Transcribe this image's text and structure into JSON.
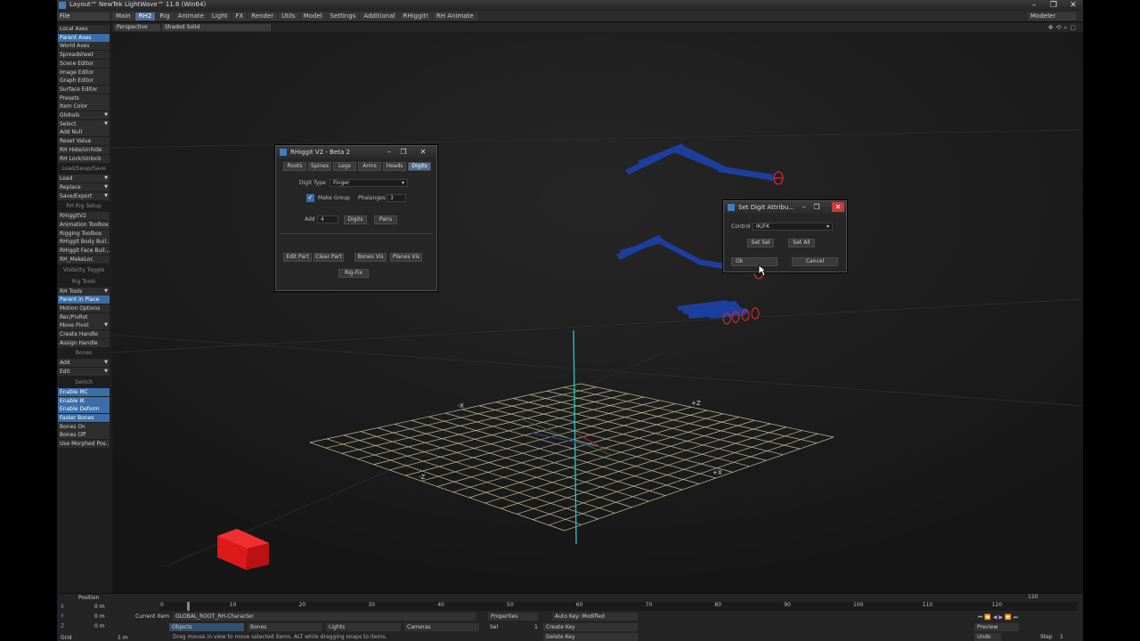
{
  "window": {
    "title": "Layout™ NewTek LightWave™ 11.6 (Win64)",
    "minimize": "–",
    "maximize": "❐",
    "close": "✕"
  },
  "menubar": {
    "file": "File",
    "tabs": [
      "Main",
      "RH2",
      "Rig",
      "Animate",
      "Light",
      "FX",
      "Render",
      "Utils",
      "Model",
      "Settings",
      "Additional",
      "RHiggit!",
      "RH Animate"
    ],
    "active_tab": "RH2",
    "modeler": "Modeler"
  },
  "viewport_bar": {
    "view": "Perspective",
    "shading": "Shaded Solid"
  },
  "toolbar": {
    "items": [
      {
        "label": "Local Axes",
        "style": "btn"
      },
      {
        "label": "Parent Axes",
        "style": "hl"
      },
      {
        "label": "World Axes",
        "style": "btn"
      },
      {
        "label": "Spreadsheet",
        "style": "btn"
      },
      {
        "label": "Scene Editor",
        "style": "btn"
      },
      {
        "label": "Image Editor",
        "style": "btn"
      },
      {
        "label": "Graph Editor",
        "style": "btn"
      },
      {
        "label": "Surface Editor",
        "style": "btn"
      },
      {
        "label": "Presets",
        "style": "btn"
      },
      {
        "label": "Item Color",
        "style": "btn"
      },
      {
        "label": "Globals",
        "style": "btn",
        "arrow": true
      },
      {
        "label": "Select",
        "style": "btn",
        "arrow": true
      },
      {
        "label": "Add Null",
        "style": "btn"
      },
      {
        "label": "Reset Value",
        "style": "btn"
      },
      {
        "label": "RH Hide/Unhide",
        "style": "btn"
      },
      {
        "label": "RH Lock/Unlock",
        "style": "btn"
      },
      {
        "label": "Load/Swap/Save",
        "style": "hdr"
      },
      {
        "label": "Load",
        "style": "btn",
        "arrow": true
      },
      {
        "label": "Replace",
        "style": "btn",
        "arrow": true
      },
      {
        "label": "Save/Export",
        "style": "btn",
        "arrow": true
      },
      {
        "label": "RH Rig Setup",
        "style": "hdr"
      },
      {
        "label": "RHiggitV2",
        "style": "btn"
      },
      {
        "label": "Animation Toolbox",
        "style": "btn"
      },
      {
        "label": "Rigging Toolbox",
        "style": "btn"
      },
      {
        "label": "RHiggit Body Buil...",
        "style": "btn"
      },
      {
        "label": "RHiggit Face Buil...",
        "style": "btn"
      },
      {
        "label": "RH_MakeLoc",
        "style": "btn"
      },
      {
        "label": "Visibility Toggle",
        "style": "hdr"
      },
      {
        "label": "Rig Tools",
        "style": "hdr"
      },
      {
        "label": "RH Tools",
        "style": "btn",
        "arrow": true
      },
      {
        "label": "Parent in Place",
        "style": "hl"
      },
      {
        "label": "Motion Options",
        "style": "btn"
      },
      {
        "label": "Rec/PivRot",
        "style": "btn"
      },
      {
        "label": "Move Pivot",
        "style": "btn",
        "arrow": true
      },
      {
        "label": "Create Handle",
        "style": "btn"
      },
      {
        "label": "Assign Handle",
        "style": "btn"
      },
      {
        "label": "Bones",
        "style": "hdr"
      },
      {
        "label": "Add",
        "style": "btn",
        "arrow": true
      },
      {
        "label": "Edit",
        "style": "btn",
        "arrow": true
      },
      {
        "label": "Switch",
        "style": "hdr"
      },
      {
        "label": "Enable MC",
        "style": "hl"
      },
      {
        "label": "Enable IK",
        "style": "hl"
      },
      {
        "label": "Enable Deform",
        "style": "hl"
      },
      {
        "label": "Faster Bones",
        "style": "hl"
      },
      {
        "label": "Bones On",
        "style": "btn"
      },
      {
        "label": "Bones Off",
        "style": "btn"
      },
      {
        "label": "Use Morphed Pos...",
        "style": "btn"
      }
    ]
  },
  "viewport": {
    "axis_labels": [
      "-X",
      "+Z",
      "-Z",
      "+X"
    ],
    "controller_color": "#1c3f9e",
    "target_color": "#e03030",
    "cube_color": "#dd1a1a",
    "grid_color": "#c8c8a0",
    "y_axis_color": "#28c0c0"
  },
  "rhiggit_dialog": {
    "title": "RHiggit V2 - Beta 2",
    "tabs": [
      "Roots",
      "Spines",
      "Legs",
      "Arms",
      "Heads",
      "Digits"
    ],
    "active_tab": "Digits",
    "digit_type_label": "Digit Type",
    "digit_type_value": "Finger",
    "make_group_label": "Make Group",
    "phalanges_label": "Phalanges",
    "phalanges_value": "3",
    "add_label": "Add",
    "add_value": "4",
    "digits_button": "Digits",
    "pairs_button": "Pairs",
    "edit_part": "Edit Part",
    "clear_part": "Clear Part",
    "bones_vis": "Bones Vis",
    "planes_vis": "Planes Vis",
    "rig_fix": "Rig-Fix"
  },
  "set_digit_dialog": {
    "title": "Set Digit Attribu...",
    "control_label": "Control",
    "control_value": "IK/FK",
    "set_sel": "Set Sel",
    "set_all": "Set All",
    "ok": "Ok",
    "cancel": "Cancel"
  },
  "timeline": {
    "position_label": "Position",
    "ticks": [
      "0",
      "10",
      "20",
      "30",
      "40",
      "50",
      "60",
      "70",
      "80",
      "90",
      "100",
      "110",
      "120"
    ],
    "end_frame": "120",
    "xyz": [
      {
        "axis": "X",
        "value": "0 m"
      },
      {
        "axis": "Y",
        "value": "0 m"
      },
      {
        "axis": "Z",
        "value": "0 m"
      }
    ],
    "grid_label": "Grid",
    "grid_value": "1 m",
    "current_item_label": "Current Item",
    "current_item_value": "GLOBAL_ROOT_RH-Character",
    "properties": "Properties",
    "sel_label": "Sel",
    "sel_value": "1",
    "auto_key": "Auto Key: Modified",
    "create_key": "Create Key",
    "delete_key": "Delete Key",
    "objects": "Objects",
    "bones": "Bones",
    "lights": "Lights",
    "cameras": "Cameras",
    "status": "Drag mouse in view to move selected items. ALT while dragging snaps to items.",
    "preview": "Preview",
    "undo": "Undo",
    "step_label": "Step",
    "step_value": "1"
  }
}
